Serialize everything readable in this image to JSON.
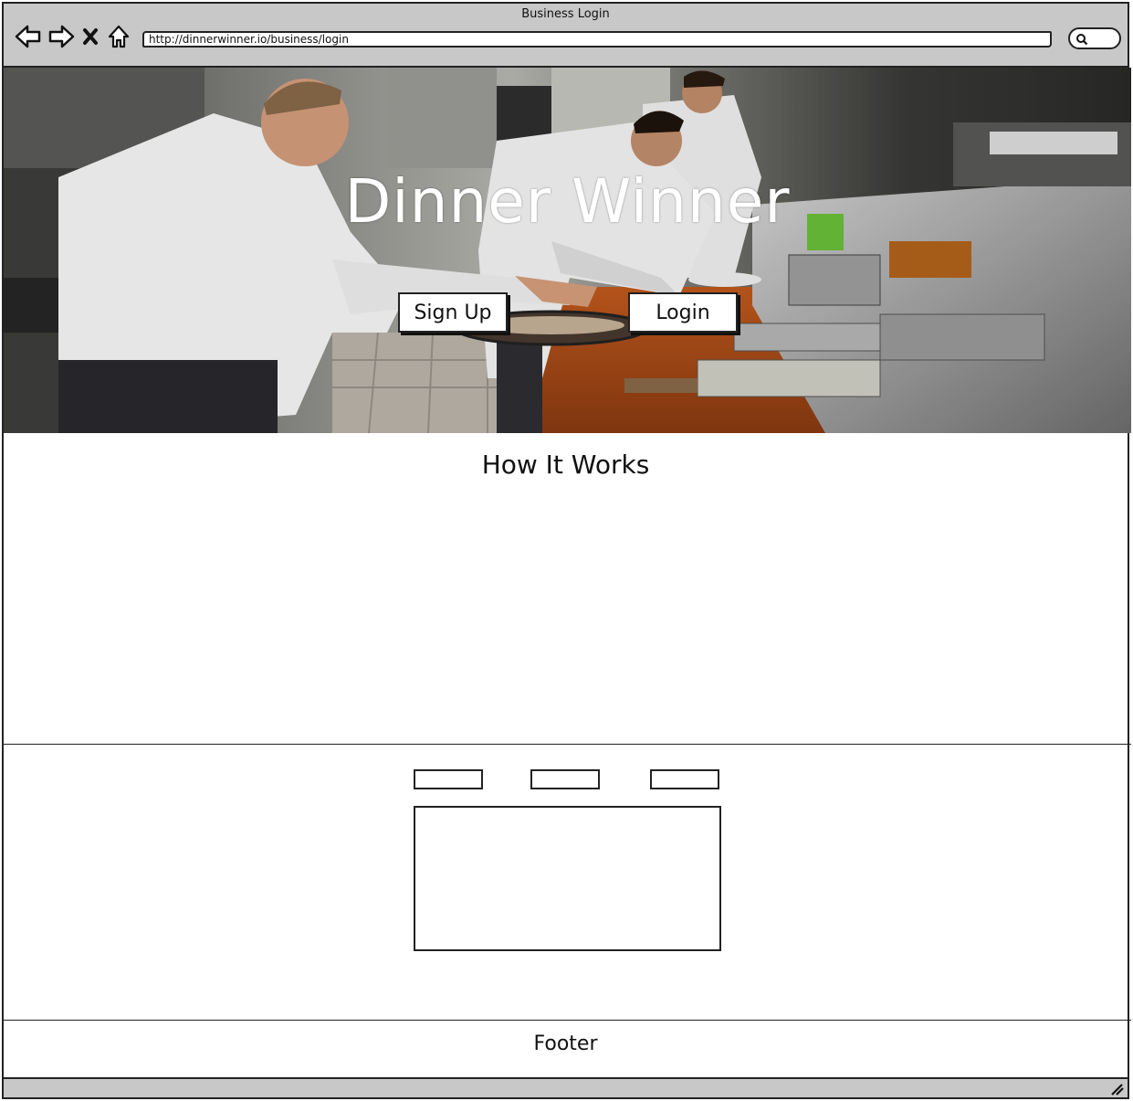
{
  "window": {
    "title": "Business Login"
  },
  "browser": {
    "url": "http://dinnerwinner.io/business/login",
    "icons": [
      "back-arrow-icon",
      "forward-arrow-icon",
      "close-x-icon",
      "home-icon",
      "search-icon"
    ]
  },
  "hero": {
    "title": "Dinner Winner",
    "signup_label": "Sign Up",
    "login_label": "Login",
    "image": "chefs in restaurant kitchen photo"
  },
  "how_it_works": {
    "title": "How It Works"
  },
  "footer": {
    "label": "Footer"
  }
}
